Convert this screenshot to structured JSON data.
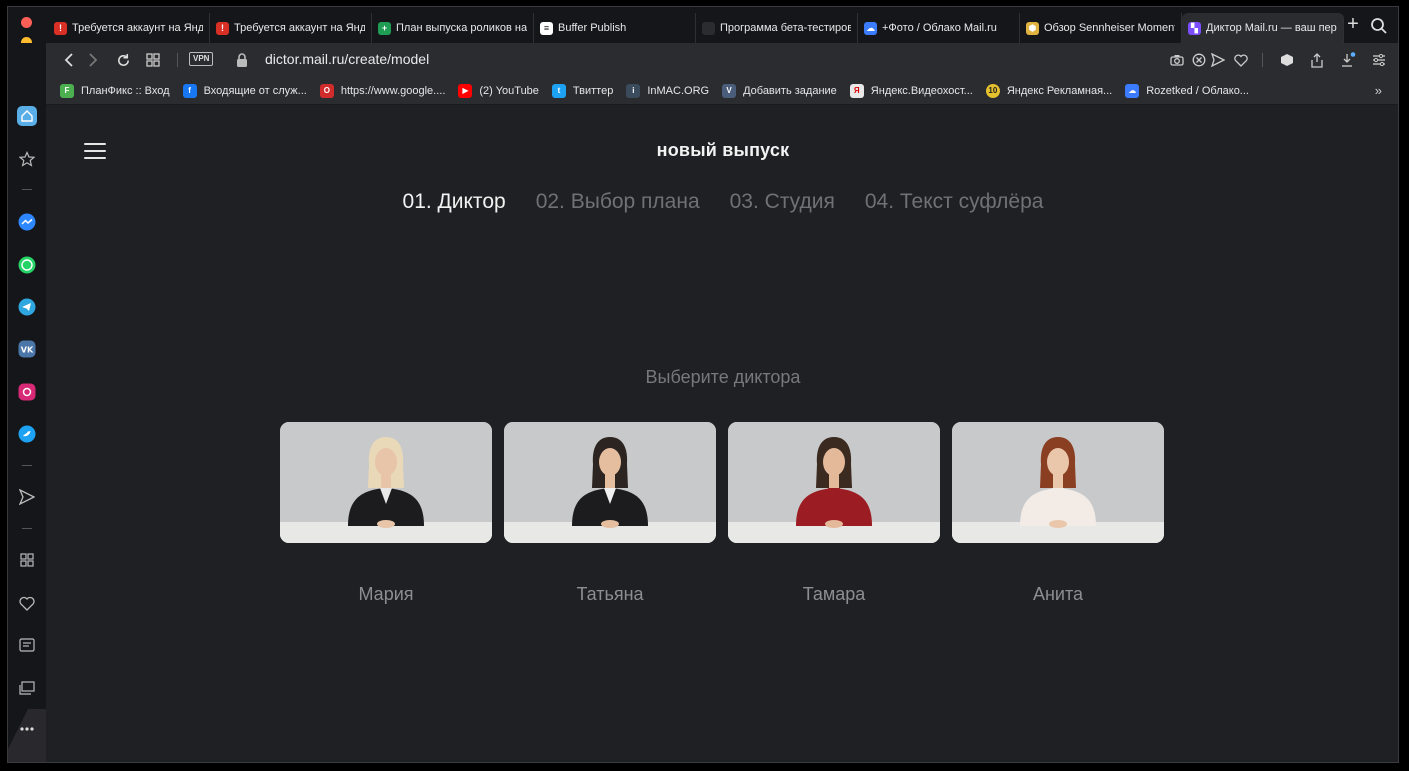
{
  "tabs": [
    {
      "title": "Требуется аккаунт на Яндекс",
      "icon": "red-shield-icon",
      "color": "#d93025",
      "glyph": "!"
    },
    {
      "title": "Требуется аккаунт на Яндекс",
      "icon": "red-shield-icon",
      "color": "#d93025",
      "glyph": "!"
    },
    {
      "title": "План выпуска роликов на",
      "icon": "sheets-icon",
      "color": "#1f9d55",
      "glyph": "+"
    },
    {
      "title": "Buffer Publish",
      "icon": "buffer-icon",
      "color": "#ffffff",
      "glyph": "≡"
    },
    {
      "title": "Программа бета-тестирования",
      "icon": "apple-icon",
      "color": "#2b2c30",
      "glyph": ""
    },
    {
      "title": "+Фото / Облако Mail.ru",
      "icon": "cloud-icon",
      "color": "#3b7cff",
      "glyph": "☁"
    },
    {
      "title": "Обзор Sennheiser Momentum",
      "icon": "hexagon-icon",
      "color": "#e0b341",
      "glyph": "⬢"
    },
    {
      "title": "Диктор Mail.ru — ваш персональный",
      "icon": "dictor-icon",
      "color": "#7b4dff",
      "glyph": "▚"
    }
  ],
  "address": {
    "url": "dictor.mail.ru/create/model",
    "vpn": "VPN"
  },
  "bookmarks": [
    {
      "label": "ПланФикс :: Вход",
      "icon": "planfix-icon",
      "color": "#4caf50",
      "glyph": "F"
    },
    {
      "label": "Входящие от служ...",
      "icon": "facebook-icon",
      "color": "#1877f2",
      "glyph": "f"
    },
    {
      "label": "https://www.google....",
      "icon": "opera-icon",
      "color": "#d12b2b",
      "glyph": "O"
    },
    {
      "label": "(2) YouTube",
      "icon": "youtube-icon",
      "color": "#ff0000",
      "glyph": "▶"
    },
    {
      "label": "Твиттер",
      "icon": "twitter-icon",
      "color": "#1da1f2",
      "glyph": "t"
    },
    {
      "label": "InMAC.ORG",
      "icon": "inmac-icon",
      "color": "#3a4b5c",
      "glyph": "i"
    },
    {
      "label": "Добавить задание",
      "icon": "v-icon",
      "color": "#4a5d7a",
      "glyph": "V"
    },
    {
      "label": "Яндекс.Видеохост...",
      "icon": "yandex-icon",
      "color": "#e8e8e8",
      "glyph": "Я"
    },
    {
      "label": "Яндекс Рекламная...",
      "icon": "ten-badge-icon",
      "color": "#e6c12e",
      "glyph": "10"
    },
    {
      "label": "Rozetked / Облако...",
      "icon": "cloud-icon",
      "color": "#3b7cff",
      "glyph": "☁"
    }
  ],
  "page": {
    "title": "новый выпуск",
    "steps": [
      "01. Диктор",
      "02. Выбор плана",
      "03. Студия",
      "04. Текст суфлёра"
    ],
    "active_step": 0,
    "prompt": "Выберите диктора",
    "presenters": [
      {
        "name": "Мария",
        "hair": "#e9d9b8",
        "outfit": "#1c1c1e",
        "shirt": "#e8e8e8",
        "skin": "#e8c4a8"
      },
      {
        "name": "Татьяна",
        "hair": "#2c2420",
        "outfit": "#1c1c1e",
        "shirt": "#f0f0f0",
        "skin": "#e5bea0"
      },
      {
        "name": "Тамара",
        "hair": "#3a2a20",
        "outfit": "#9b1c22",
        "shirt": "#9b1c22",
        "skin": "#e3b99a"
      },
      {
        "name": "Анита",
        "hair": "#8b3f22",
        "outfit": "#f2ebe6",
        "shirt": "#f2ebe6",
        "skin": "#eac7ab"
      }
    ]
  }
}
